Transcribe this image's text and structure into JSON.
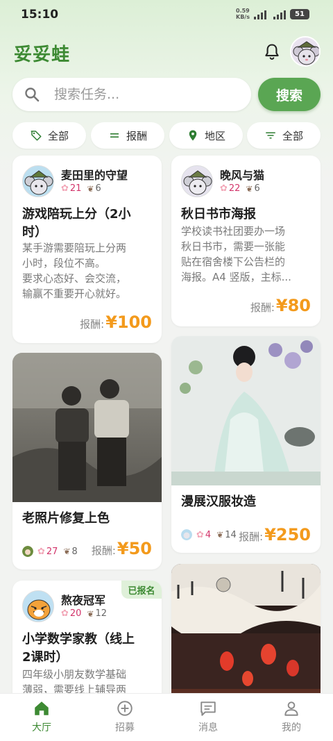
{
  "status_bar": {
    "time": "15:10",
    "net_speed": "0.59",
    "net_unit": "KB/s",
    "sig1": "5G",
    "sig2": "5G",
    "battery": "51"
  },
  "header": {
    "app_title": "妥妥蛙",
    "bell_icon": "bell-icon",
    "avatar_icon": "user-avatar"
  },
  "search": {
    "placeholder": "搜索任务...",
    "button_label": "搜索",
    "icon": "search-icon"
  },
  "filters": [
    {
      "label": "全部",
      "icon": "tag-icon"
    },
    {
      "label": "报酬",
      "icon": "lines-icon"
    },
    {
      "label": "地区",
      "icon": "location-pin-icon"
    },
    {
      "label": "全部",
      "icon": "filter-icon"
    }
  ],
  "cards": [
    {
      "user": "麦田里的守望",
      "flowers": "21",
      "leaves": "6",
      "title_l1": "游戏陪玩上分（2小",
      "title_l2": "时）",
      "desc": [
        "某手游需要陪玩上分两",
        "小时，段位不高。",
        "要求心态好、会交流，",
        "输赢不重要开心就好。"
      ],
      "reward_label": "报酬:",
      "reward_value": "¥100"
    },
    {
      "user": "晚风与猫",
      "flowers": "22",
      "leaves": "6",
      "title_l1": "秋日书市海报",
      "desc": [
        "学校读书社团要办一场",
        "秋日书市，需要一张能",
        "贴在宿舍楼下公告栏的",
        "海报。A4 竖版，主标..."
      ],
      "reward_label": "报酬:",
      "reward_value": "¥80"
    },
    {
      "title_l1": "老照片修复上色",
      "flowers": "27",
      "leaves": "8",
      "reward_label": "报酬:",
      "reward_value": "¥50"
    },
    {
      "title_l1": "漫展汉服妆造",
      "flowers": "4",
      "leaves": "14",
      "reward_label": "报酬:",
      "reward_value": "¥250"
    },
    {
      "badge": "已报名",
      "user": "熬夜冠军",
      "flowers": "20",
      "leaves": "12",
      "title_l1": "小学数学家教（线上",
      "title_l2": "2课时）",
      "desc": [
        "四年级小朋友数学基础",
        "薄弱，需要线上辅导两"
      ]
    }
  ],
  "nav": [
    {
      "label": "大厅",
      "icon": "home-icon",
      "active": true
    },
    {
      "label": "招募",
      "icon": "plus-circle-icon"
    },
    {
      "label": "消息",
      "icon": "message-icon"
    },
    {
      "label": "我的",
      "icon": "person-icon"
    }
  ],
  "colors": {
    "brand": "#3d8a33",
    "accent_green": "#5aa653",
    "reward": "#f39a1c",
    "flower_count": "#d2346a"
  }
}
